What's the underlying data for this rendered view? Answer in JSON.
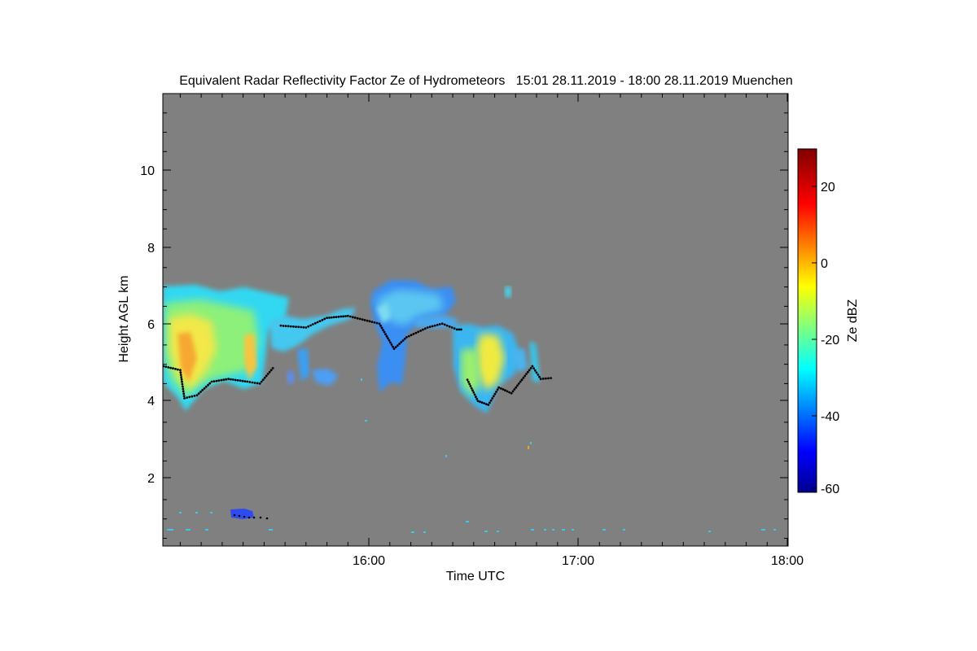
{
  "chart_data": {
    "type": "heatmap",
    "title": "Equivalent Radar Reflectivity Factor Ze of Hydrometeors   15:01 28.11.2019 - 18:00 28.11.2019 Muenchen",
    "xlabel": "Time UTC",
    "ylabel": "Height AGL km",
    "x_ticks": [
      "16:00",
      "17:00",
      "18:00"
    ],
    "y_ticks": [
      "2",
      "4",
      "6",
      "8",
      "10"
    ],
    "xlim_hours": [
      15.017,
      18.0
    ],
    "ylim_km": [
      0.3,
      12.0
    ],
    "background_color": "#808080",
    "colorbar": {
      "label": "Ze dBZ",
      "range": [
        -60,
        30
      ],
      "ticks": [
        "-60",
        "-40",
        "-20",
        "0",
        "20"
      ],
      "colormap": "jet"
    },
    "echo_regions": [
      {
        "t_start": 15.02,
        "t_end": 15.5,
        "base_km": 4.0,
        "top_km": 7.0,
        "ze_mean": -20,
        "ze_peak": 0
      },
      {
        "t_start": 15.5,
        "t_end": 15.95,
        "base_km": 4.6,
        "top_km": 6.5,
        "ze_mean": -28,
        "ze_peak": -20
      },
      {
        "t_start": 16.02,
        "t_end": 16.45,
        "base_km": 4.2,
        "top_km": 7.1,
        "ze_mean": -30,
        "ze_peak": -20
      },
      {
        "t_start": 16.45,
        "t_end": 16.88,
        "base_km": 3.7,
        "top_km": 6.0,
        "ze_mean": -18,
        "ze_peak": 0
      },
      {
        "t_start": 15.33,
        "t_end": 15.47,
        "base_km": 0.9,
        "top_km": 1.2,
        "ze_mean": -40,
        "ze_peak": -35
      }
    ],
    "overlay_line": {
      "description": "black dotted line",
      "points": [
        [
          15.02,
          4.95
        ],
        [
          15.1,
          4.85
        ],
        [
          15.12,
          4.12
        ],
        [
          15.18,
          4.2
        ],
        [
          15.25,
          4.55
        ],
        [
          15.33,
          4.62
        ],
        [
          15.42,
          4.55
        ],
        [
          15.48,
          4.5
        ],
        [
          15.55,
          4.95
        ],
        [
          15.58,
          6.0
        ],
        [
          15.7,
          5.95
        ],
        [
          15.8,
          6.2
        ],
        [
          15.9,
          6.25
        ],
        [
          16.05,
          6.05
        ],
        [
          16.12,
          5.4
        ],
        [
          16.18,
          5.7
        ],
        [
          16.28,
          5.95
        ],
        [
          16.35,
          6.05
        ],
        [
          16.42,
          5.9
        ],
        [
          16.45,
          5.9
        ],
        [
          16.47,
          4.6
        ],
        [
          16.52,
          4.05
        ],
        [
          16.57,
          3.95
        ],
        [
          16.62,
          4.4
        ],
        [
          16.68,
          4.25
        ],
        [
          16.73,
          4.6
        ],
        [
          16.78,
          4.95
        ],
        [
          16.82,
          4.62
        ],
        [
          16.88,
          4.65
        ]
      ]
    }
  }
}
